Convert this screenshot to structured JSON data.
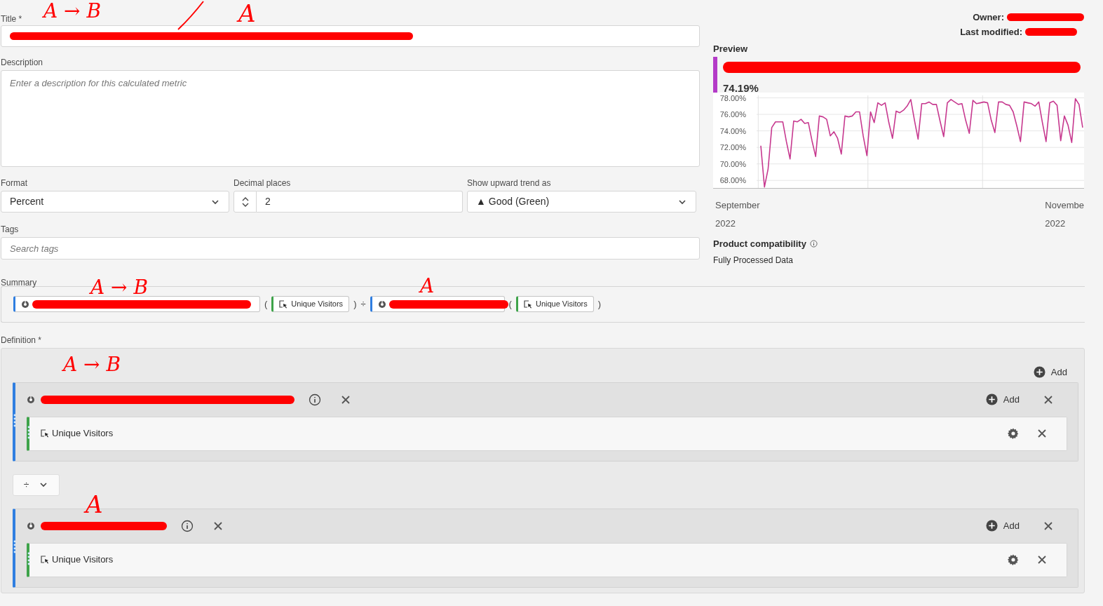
{
  "header": {
    "owner_label": "Owner:",
    "modified_label": "Last modified:"
  },
  "title": {
    "label": "Title *",
    "annotations": [
      "A → B",
      "A"
    ]
  },
  "description": {
    "label": "Description",
    "placeholder": "Enter a description for this calculated metric"
  },
  "format": {
    "label": "Format",
    "value": "Percent"
  },
  "decimal_places": {
    "label": "Decimal places",
    "value": "2"
  },
  "upward_trend": {
    "label": "Show upward trend as",
    "value": "▲ Good (Green)"
  },
  "tags": {
    "label": "Tags",
    "placeholder": "Search tags"
  },
  "summary": {
    "label": "Summary",
    "tokens": [
      {
        "kind": "segment",
        "annotation": "A → B"
      },
      {
        "kind": "paren",
        "text": "("
      },
      {
        "kind": "metric",
        "text": "Unique Visitors"
      },
      {
        "kind": "paren",
        "text": ")"
      },
      {
        "kind": "operator",
        "text": "÷"
      },
      {
        "kind": "segment",
        "annotation": "A"
      },
      {
        "kind": "paren",
        "text": "("
      },
      {
        "kind": "metric",
        "text": "Unique Visitors"
      },
      {
        "kind": "paren",
        "text": ")"
      }
    ]
  },
  "definition": {
    "label": "Definition *",
    "add_label": "Add",
    "operator": "÷",
    "groups": [
      {
        "annotation": "A → B",
        "add_label": "Add",
        "metric": "Unique Visitors"
      },
      {
        "annotation": "A",
        "add_label": "Add",
        "metric": "Unique Visitors"
      }
    ]
  },
  "preview": {
    "label": "Preview",
    "value": "74.19%",
    "chart_data": {
      "type": "line",
      "grid": true,
      "ylim": [
        67.0,
        78.3
      ],
      "yticks": [
        {
          "value": 68,
          "label": "68.00%"
        },
        {
          "value": 70,
          "label": "70.00%"
        },
        {
          "value": 72,
          "label": "72.00%"
        },
        {
          "value": 74,
          "label": "74.00%"
        },
        {
          "value": 76,
          "label": "76.00%"
        },
        {
          "value": 78,
          "label": "78.00%"
        }
      ],
      "series": [
        {
          "color": "#c7398f",
          "values": [
            72.2,
            67.2,
            69.4,
            74.4,
            75.1,
            75.1,
            75.1,
            72.7,
            70.6,
            75.2,
            75.1,
            75.4,
            74.9,
            75.0,
            72.8,
            70.9,
            75.8,
            75.7,
            75.4,
            73.4,
            73.9,
            73.1,
            71.2,
            75.8,
            75.7,
            75.8,
            76.3,
            76.3,
            73.4,
            71.0,
            76.3,
            75.0,
            77.4,
            77.1,
            77.4,
            75.0,
            73.1,
            76.4,
            76.2,
            76.5,
            77.0,
            77.8,
            75.3,
            73.0,
            77.3,
            77.3,
            77.5,
            77.2,
            77.2,
            75.2,
            73.3,
            77.4,
            77.8,
            77.5,
            77.2,
            77.3,
            75.3,
            73.7,
            77.7,
            77.3,
            77.4,
            77.5,
            77.4,
            75.3,
            73.8,
            77.5,
            77.5,
            77.2,
            77.1,
            76.3,
            74.6,
            72.7,
            77.5,
            77.4,
            77.3,
            77.0,
            77.5,
            75.0,
            72.7,
            77.4,
            77.6,
            77.1,
            72.8,
            75.8,
            74.7,
            72.6,
            77.9,
            77.2,
            74.4
          ]
        }
      ]
    },
    "x_labels": [
      {
        "month": "September",
        "year": "2022"
      },
      {
        "month": "Novembe",
        "year": "2022"
      }
    ]
  },
  "compatibility": {
    "label": "Product compatibility",
    "value": "Fully Processed Data"
  }
}
